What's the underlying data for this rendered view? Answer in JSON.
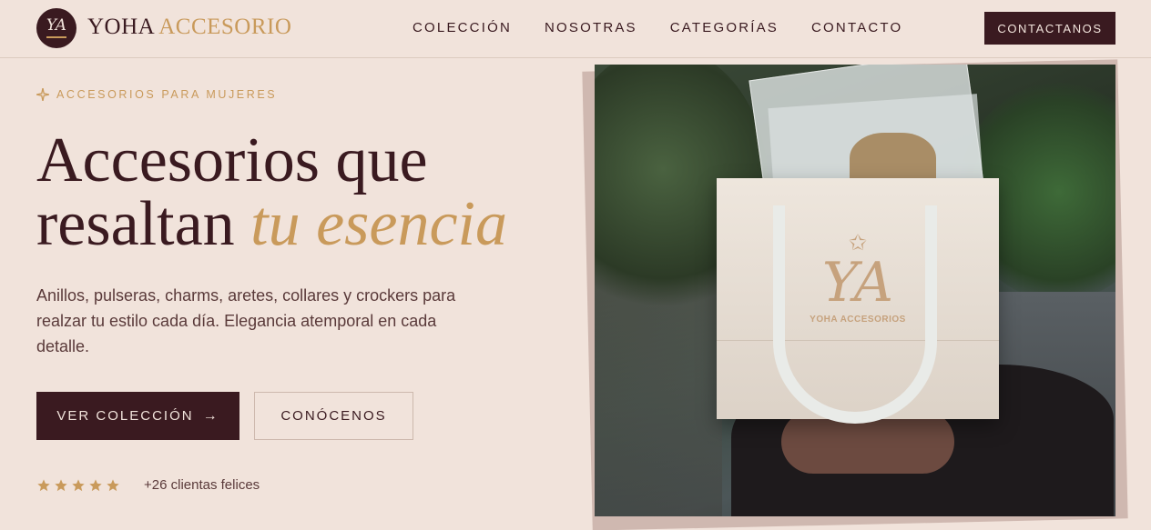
{
  "brand": {
    "monogram": "YA",
    "name_part1": "YOHA",
    "name_part2": "ACCESORIO"
  },
  "nav": {
    "links": [
      "COLECCIÓN",
      "NOSOTRAS",
      "CATEGORÍAS",
      "CONTACTO"
    ],
    "cta_label": "CONTACTANOS"
  },
  "hero": {
    "eyebrow": "ACCESORIOS PARA MUJERES",
    "headline_line1": "Accesorios que",
    "headline_line2_plain": "resaltan",
    "headline_line2_accent": "tu esencia",
    "lead": "Anillos, pulseras, charms, aretes, collares y crockers para realzar tu estilo cada día. Elegancia atemporal en cada detalle.",
    "primary_button": "VER COLECCIÓN",
    "primary_button_arrow": "→",
    "secondary_button": "CONÓCENOS",
    "rating_stars": 5,
    "rating_text": "+26 clientas felices"
  },
  "photo": {
    "bag_monogram": "YA",
    "bag_star": "✩",
    "bag_label": "YOHA ACCESORIOS"
  },
  "colors": {
    "background": "#f1e3db",
    "primary": "#3a1a20",
    "accent": "#c99a5b"
  },
  "icons": {
    "eyebrow": "sparkle-icon",
    "button_arrow": "arrow-right-icon",
    "rating": "star-icon"
  }
}
